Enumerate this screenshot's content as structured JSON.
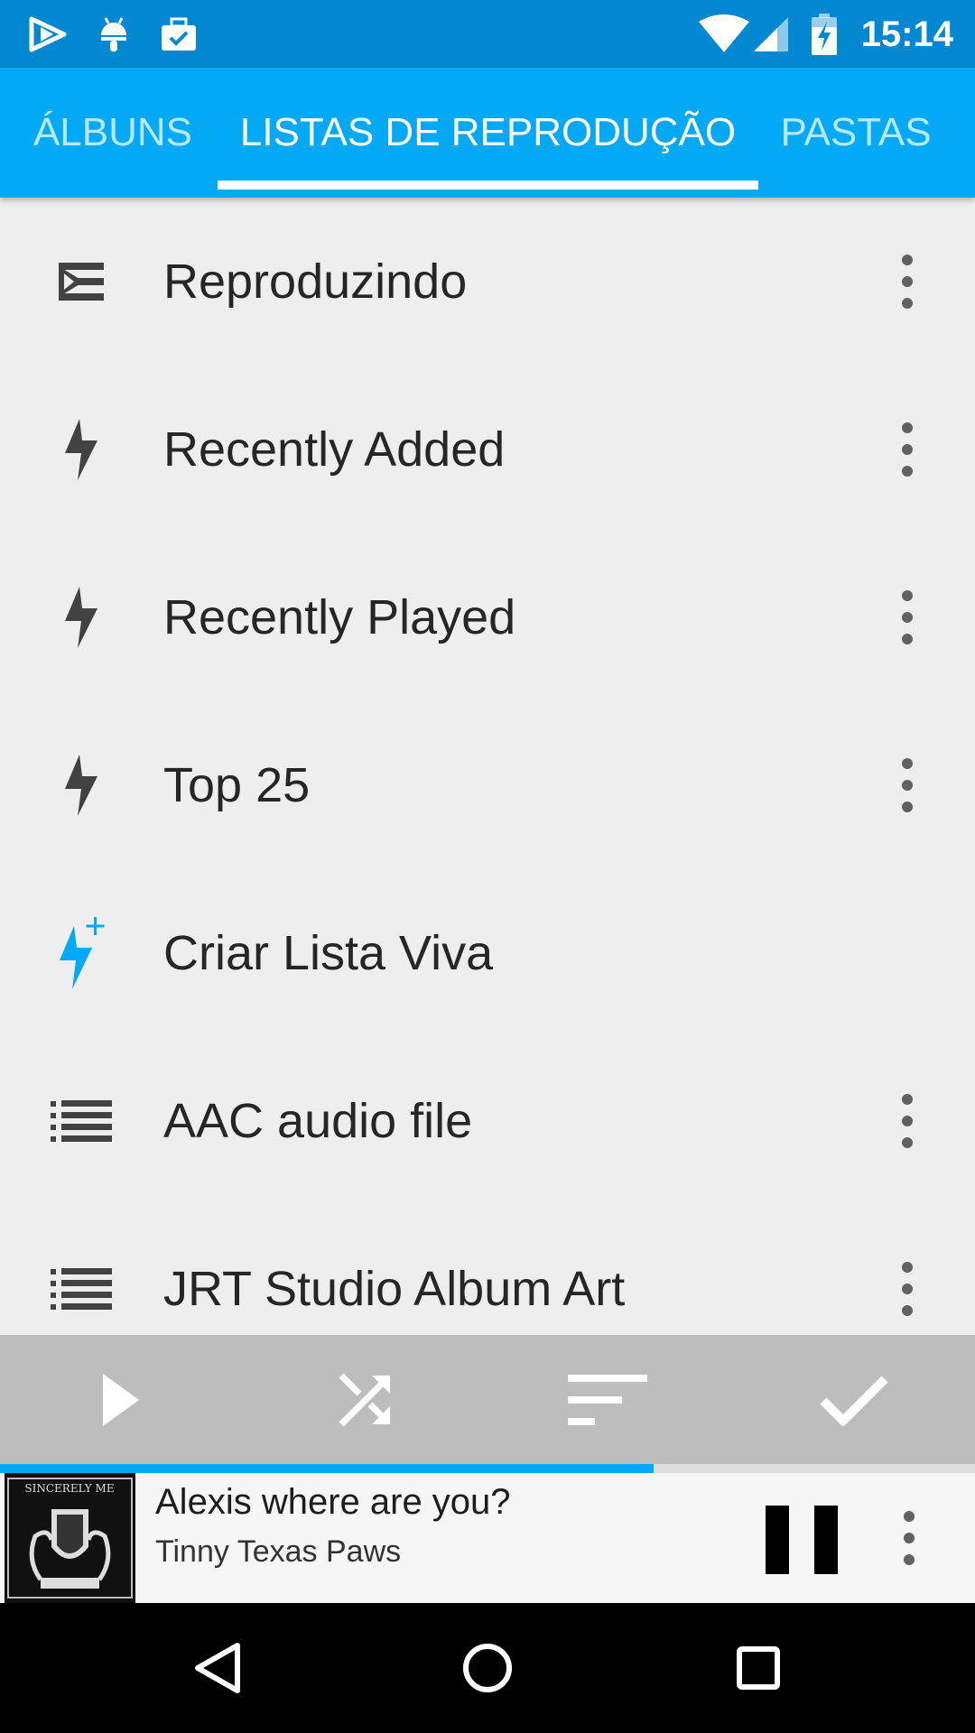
{
  "status_bar": {
    "time": "15:14",
    "left_icons": [
      "play-store-icon",
      "android-icon",
      "briefcase-check-icon"
    ],
    "right_icons": [
      "wifi-icon",
      "signal-icon",
      "battery-charging-icon"
    ]
  },
  "tabs": [
    {
      "label": "ÁLBUNS",
      "active": false
    },
    {
      "label": "LISTAS DE REPRODUÇÃO",
      "active": true
    },
    {
      "label": "PASTAS",
      "active": false
    }
  ],
  "playlists": [
    {
      "label": "Reproduzindo",
      "icon": "queue-icon"
    },
    {
      "label": "Recently Added",
      "icon": "bolt-icon"
    },
    {
      "label": "Recently Played",
      "icon": "bolt-icon"
    },
    {
      "label": "Top 25",
      "icon": "bolt-icon"
    },
    {
      "label": "Criar Lista Viva",
      "icon": "bolt-plus-icon"
    },
    {
      "label": "AAC audio file",
      "icon": "list-icon"
    },
    {
      "label": "JRT Studio Album Art",
      "icon": "list-icon"
    }
  ],
  "action_bar": [
    "play-icon",
    "shuffle-icon",
    "sort-icon",
    "check-icon"
  ],
  "now_playing": {
    "title": "Alexis where are you?",
    "artist": "Tinny Texas Paws",
    "progress": 0.67,
    "album_art_text": "SINCERELY ME"
  },
  "nav_bar": [
    "back-icon",
    "home-icon",
    "recents-icon"
  ],
  "colors": {
    "status_bar": "#0288d1",
    "tab_bar": "#03a9f4",
    "accent": "#03a9f4",
    "list_background": "#eeeeee",
    "action_bar": "#bdbdbd",
    "icon_gray": "#424242"
  }
}
